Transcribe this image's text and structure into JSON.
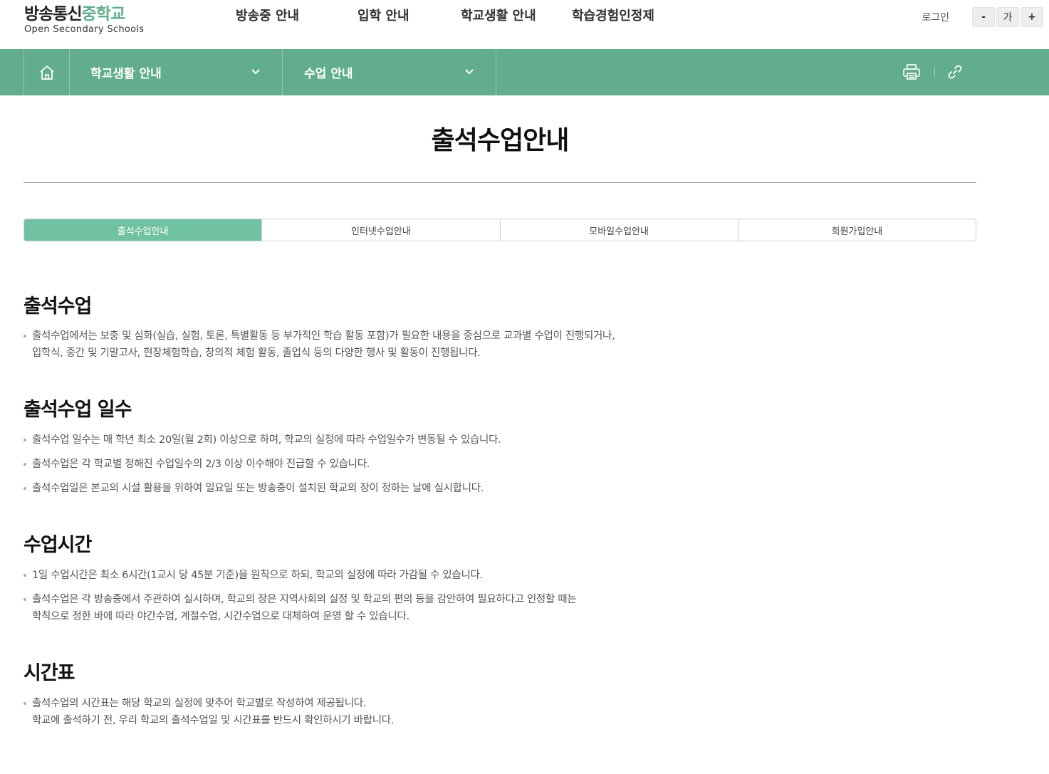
{
  "header": {
    "logo_main_1": "방송통신",
    "logo_main_2": "중학교",
    "logo_sub": "Open Secondary Schools",
    "nav": [
      "방송중 안내",
      "입학 안내",
      "학교생활 안내",
      "학습경험인정제"
    ],
    "login": "로그인",
    "font_minus": "-",
    "font_default": "가",
    "font_plus": "+"
  },
  "subnav": {
    "home_icon": "home-icon",
    "dropdown1": "학교생활 안내",
    "dropdown2": "수업 안내",
    "print_icon": "print-icon",
    "link_icon": "link-icon",
    "bg_color": "#62ad8e"
  },
  "page": {
    "title": "출석수업안내"
  },
  "tabs": [
    "출석수업안내",
    "인터넷수업안내",
    "모바일수업안내",
    "회원가입안내"
  ],
  "active_tab_color": "#71c2a2",
  "sections": [
    {
      "heading": "출석수업",
      "bullets": [
        [
          "출석수업에서는 보충 및 심화(실습, 실험, 토론, 특별활동 등 부가적인 학습 활동 포함)가 필요한 내용을 중심으로 교과별 수업이 진행되거나,",
          "입학식, 중간 및 기말고사, 현장체험학습, 창의적 체험 활동, 졸업식 등의 다양한 행사 및 활동이 진행됩니다."
        ]
      ]
    },
    {
      "heading": "출석수업 일수",
      "bullets": [
        [
          "출석수업 일수는 매 학년 최소 20일(월 2회) 이상으로 하며, 학교의 실정에 따라 수업일수가 변동될 수 있습니다."
        ],
        [
          "출석수업은 각 학교별 정해진 수업일수의 2/3 이상 이수해야 진급할 수 있습니다."
        ],
        [
          "출석수업일은 본교의 시설 활용을 위하여 일요일 또는 방송중이 설치된 학교의 장이 정하는 날에 실시합니다."
        ]
      ]
    },
    {
      "heading": "수업시간",
      "bullets": [
        [
          "1일 수업시간은 최소 6시간(1교시 당 45분 기준)을 원칙으로 하되, 학교의 실정에 따라 가감될 수 있습니다."
        ],
        [
          "출석수업은 각 방송중에서 주관하여 실시하며, 학교의 장은 지역사회의 실정 및 학교의 편의 등을 감안하여 필요하다고 인정할 때는",
          "학칙으로 정한 바에 따라 야간수업, 계절수업, 시간수업으로 대체하여 운영 할 수 있습니다."
        ]
      ]
    },
    {
      "heading": "시간표",
      "bullets": [
        [
          "출석수업의 시간표는 해당 학교의 실정에 맞추어 학교별로 작성하여 제공됩니다.",
          "학교에 출석하기 전, 우리 학교의 출석수업일 및 시간표를 반드시 확인하시기 바랍니다."
        ]
      ]
    }
  ]
}
